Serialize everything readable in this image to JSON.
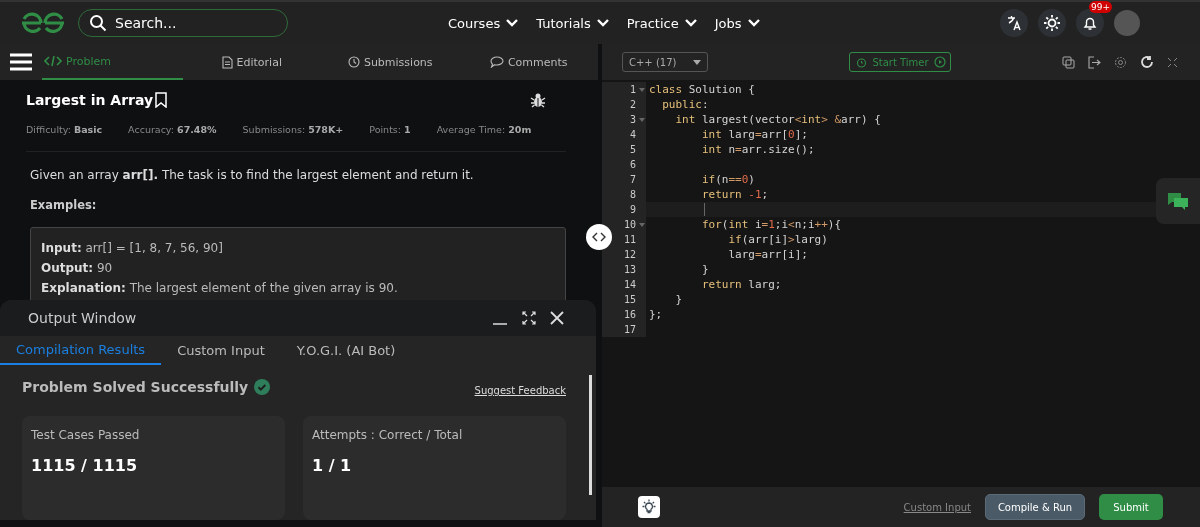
{
  "nav": {
    "search": {
      "placeholder": "Search..."
    },
    "menus": [
      "Courses",
      "Tutorials",
      "Practice",
      "Jobs"
    ],
    "notifications": "99+"
  },
  "problem_tabs": [
    {
      "label": "Problem",
      "selected": true
    },
    {
      "label": "Editorial",
      "selected": false
    },
    {
      "label": "Submissions",
      "selected": false
    },
    {
      "label": "Comments",
      "selected": false
    }
  ],
  "problem": {
    "title": "Largest in Array",
    "meta": [
      "Difficulty: **Basic**",
      "Accuracy: **67.48%**",
      "Submissions: **578K+**",
      "Points: **1**",
      "Average Time: **20m**"
    ],
    "description": "Given an array **arr[].** The task is to find the largest element and return it.",
    "examples_heading": "Examples:",
    "example": [
      "**Input:** arr[] = [1, 8, 7, 56, 90]",
      "**Output:** 90",
      "**Explanation:** The largest element of the given array is 90."
    ]
  },
  "output_window": {
    "title": "Output Window",
    "tabs": [
      {
        "label": "Compilation Results",
        "selected": true
      },
      {
        "label": "Custom Input",
        "selected": false
      },
      {
        "label": "Y.O.G.I. (AI Bot)",
        "selected": false
      }
    ],
    "status": "Problem Solved Successfully",
    "feedback": "Suggest Feedback",
    "cards": [
      {
        "label": "Test Cases Passed",
        "value": "1115 / 1115"
      },
      {
        "label": "Attempts : Correct / Total",
        "value": "1 / 1"
      }
    ]
  },
  "editor": {
    "language": "C++ (17)",
    "timer": "Start Timer",
    "lines": [
      {
        "number": "1",
        "foldable": true,
        "segments": [
          {
            "kind": "keyword",
            "text": "class"
          },
          {
            "kind": "plain",
            "text": " Solution {"
          }
        ]
      },
      {
        "number": "2",
        "foldable": false,
        "segments": [
          {
            "kind": "keyword",
            "text": "  public"
          },
          {
            "kind": "plain",
            "text": ":"
          }
        ]
      },
      {
        "number": "3",
        "foldable": true,
        "segments": [
          {
            "kind": "keyword",
            "text": "    int"
          },
          {
            "kind": "plain",
            "text": " largest(vector"
          },
          {
            "kind": "operator",
            "text": "<"
          },
          {
            "kind": "keyword",
            "text": "int"
          },
          {
            "kind": "operator",
            "text": ">"
          },
          {
            "kind": "operator",
            "text": " &"
          },
          {
            "kind": "plain",
            "text": "arr) {"
          }
        ]
      },
      {
        "number": "4",
        "foldable": false,
        "segments": [
          {
            "kind": "keyword",
            "text": "        int"
          },
          {
            "kind": "plain",
            "text": " larg"
          },
          {
            "kind": "operator",
            "text": "="
          },
          {
            "kind": "plain",
            "text": "arr["
          },
          {
            "kind": "number",
            "text": "0"
          },
          {
            "kind": "plain",
            "text": "];"
          }
        ]
      },
      {
        "number": "5",
        "foldable": false,
        "segments": [
          {
            "kind": "keyword",
            "text": "        int"
          },
          {
            "kind": "plain",
            "text": " n"
          },
          {
            "kind": "operator",
            "text": "="
          },
          {
            "kind": "plain",
            "text": "arr.size();"
          }
        ]
      },
      {
        "number": "6",
        "foldable": false
      },
      {
        "number": "7",
        "foldable": false,
        "segments": [
          {
            "kind": "keyword",
            "text": "        if"
          },
          {
            "kind": "plain",
            "text": "(n"
          },
          {
            "kind": "operator",
            "text": "=="
          },
          {
            "kind": "number",
            "text": "0"
          },
          {
            "kind": "plain",
            "text": ")"
          }
        ]
      },
      {
        "number": "8",
        "foldable": false,
        "segments": [
          {
            "kind": "keyword",
            "text": "        return"
          },
          {
            "kind": "number",
            "text": " -1"
          },
          {
            "kind": "plain",
            "text": ";"
          }
        ]
      },
      {
        "number": "9",
        "foldable": false,
        "current": true
      },
      {
        "number": "10",
        "foldable": true,
        "segments": [
          {
            "kind": "keyword",
            "text": "        for"
          },
          {
            "kind": "plain",
            "text": "("
          },
          {
            "kind": "keyword",
            "text": "int"
          },
          {
            "kind": "plain",
            "text": " i"
          },
          {
            "kind": "operator",
            "text": "="
          },
          {
            "kind": "number",
            "text": "1"
          },
          {
            "kind": "plain",
            "text": ";i"
          },
          {
            "kind": "operator",
            "text": "<"
          },
          {
            "kind": "plain",
            "text": "n;i"
          },
          {
            "kind": "operator",
            "text": "++"
          },
          {
            "kind": "plain",
            "text": "){"
          }
        ]
      },
      {
        "number": "11",
        "foldable": false,
        "segments": [
          {
            "kind": "keyword",
            "text": "            if"
          },
          {
            "kind": "plain",
            "text": "(arr[i]"
          },
          {
            "kind": "operator",
            "text": ">"
          },
          {
            "kind": "plain",
            "text": "larg)"
          }
        ]
      },
      {
        "number": "12",
        "foldable": false,
        "segments": [
          {
            "kind": "plain",
            "text": "            larg"
          },
          {
            "kind": "operator",
            "text": "="
          },
          {
            "kind": "plain",
            "text": "arr[i];"
          }
        ]
      },
      {
        "number": "13",
        "foldable": false,
        "segments": [
          {
            "kind": "plain",
            "text": "        }"
          }
        ]
      },
      {
        "number": "14",
        "foldable": false,
        "segments": [
          {
            "kind": "keyword",
            "text": "        return"
          },
          {
            "kind": "plain",
            "text": " larg;"
          }
        ]
      },
      {
        "number": "15",
        "foldable": false,
        "segments": [
          {
            "kind": "plain",
            "text": "    }"
          }
        ]
      },
      {
        "number": "16",
        "foldable": false,
        "segments": [
          {
            "kind": "plain",
            "text": "};"
          }
        ]
      },
      {
        "number": "17",
        "foldable": false
      }
    ],
    "footer": {
      "custom_input": "Custom Input",
      "compile": "Compile & Run",
      "submit": "Submit"
    }
  }
}
